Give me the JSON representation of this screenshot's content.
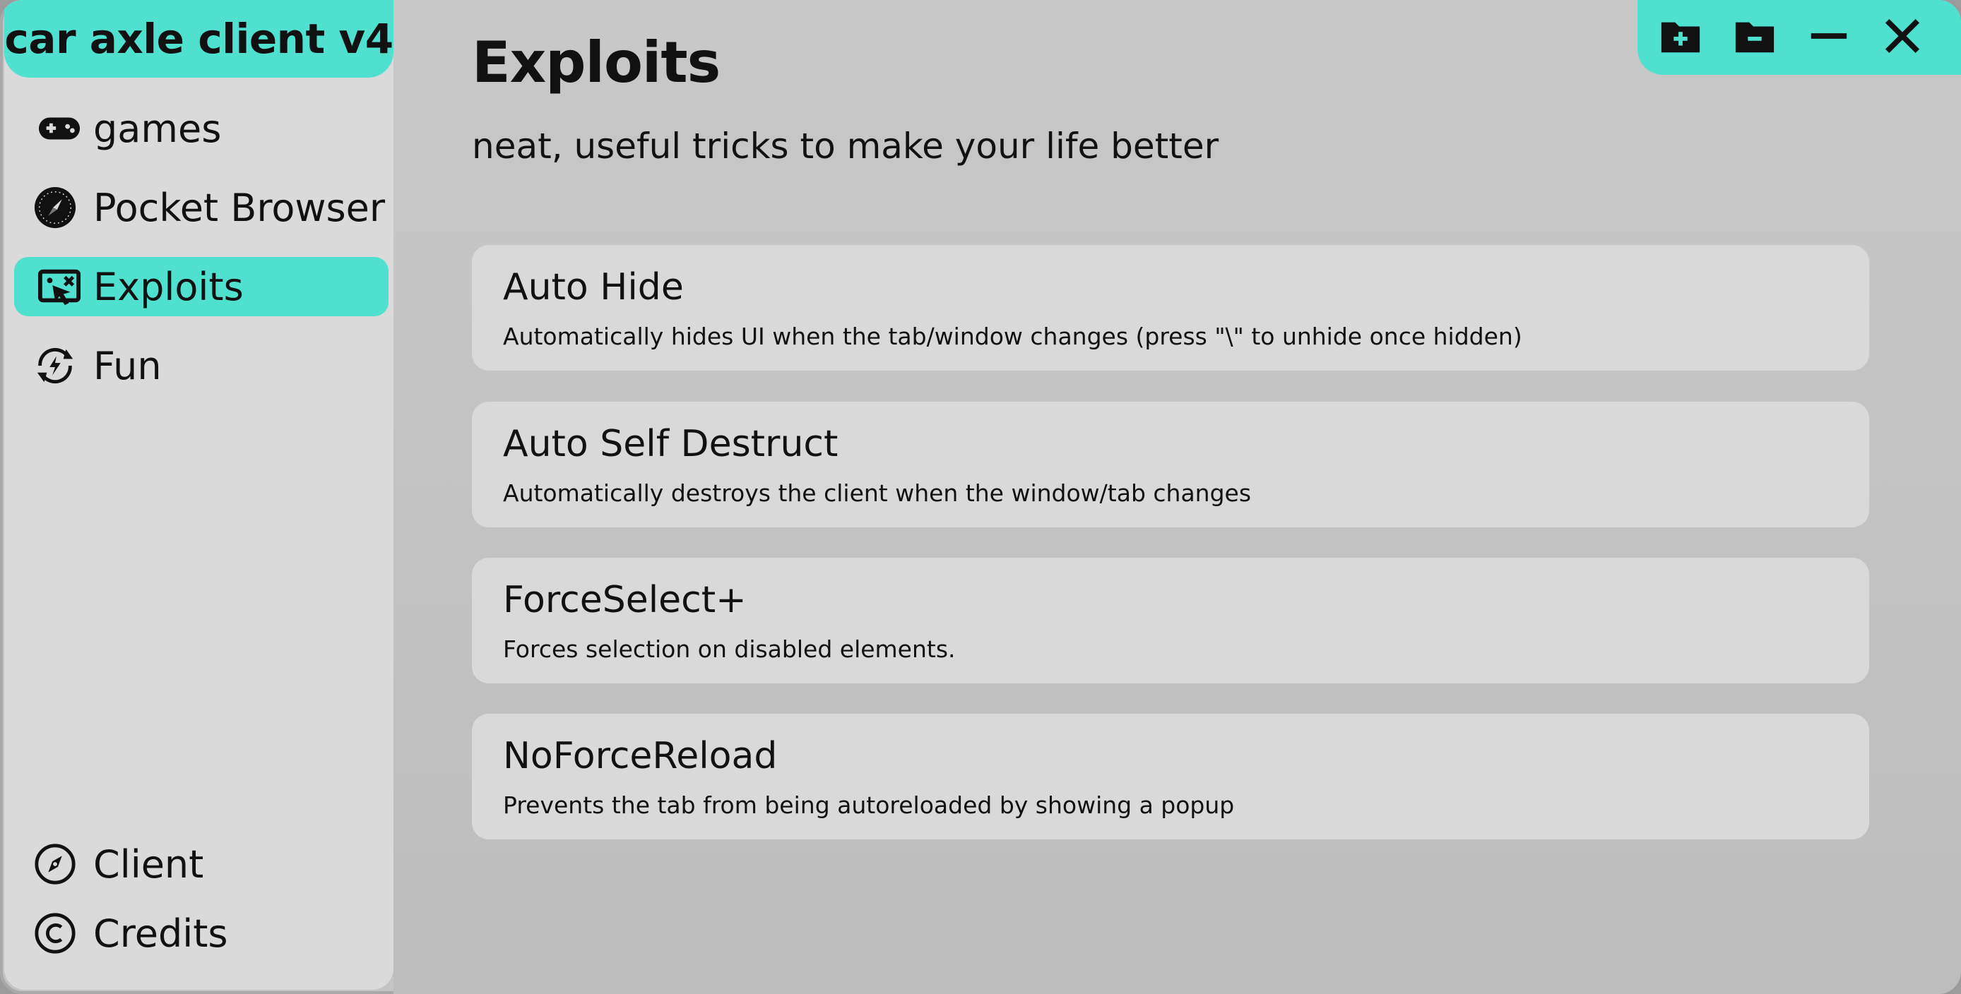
{
  "app": {
    "title": "car axle client v4"
  },
  "sidebar": {
    "items": [
      {
        "label": "games",
        "icon": "gamepad-icon"
      },
      {
        "label": "Pocket Browser",
        "icon": "compass-icon"
      },
      {
        "label": "Exploits",
        "icon": "exploit-cursor-icon",
        "active": true
      },
      {
        "label": "Fun",
        "icon": "fun-cycle-icon"
      }
    ],
    "bottom_items": [
      {
        "label": "Client",
        "icon": "compass-outline-icon"
      },
      {
        "label": "Credits",
        "icon": "copyright-icon"
      }
    ]
  },
  "main": {
    "title": "Exploits",
    "subtitle": "neat, useful tricks to make your life better",
    "cards": [
      {
        "title": "Auto Hide",
        "description": "Automatically hides UI when the tab/window changes (press \"\\\" to unhide once hidden)"
      },
      {
        "title": "Auto Self Destruct",
        "description": "Automatically destroys the client when the window/tab changes"
      },
      {
        "title": "ForceSelect+",
        "description": "Forces selection on disabled elements."
      },
      {
        "title": "NoForceReload",
        "description": "Prevents the tab from being autoreloaded by showing a popup"
      }
    ]
  },
  "window_controls": [
    "folder-plus-icon",
    "folder-minus-icon",
    "minimize-icon",
    "close-icon"
  ],
  "colors": {
    "accent": "#4fe0d0",
    "sidebar": "#dadada",
    "card": "#d9d9d9",
    "background": "#c4c4c4",
    "text": "#111111"
  }
}
